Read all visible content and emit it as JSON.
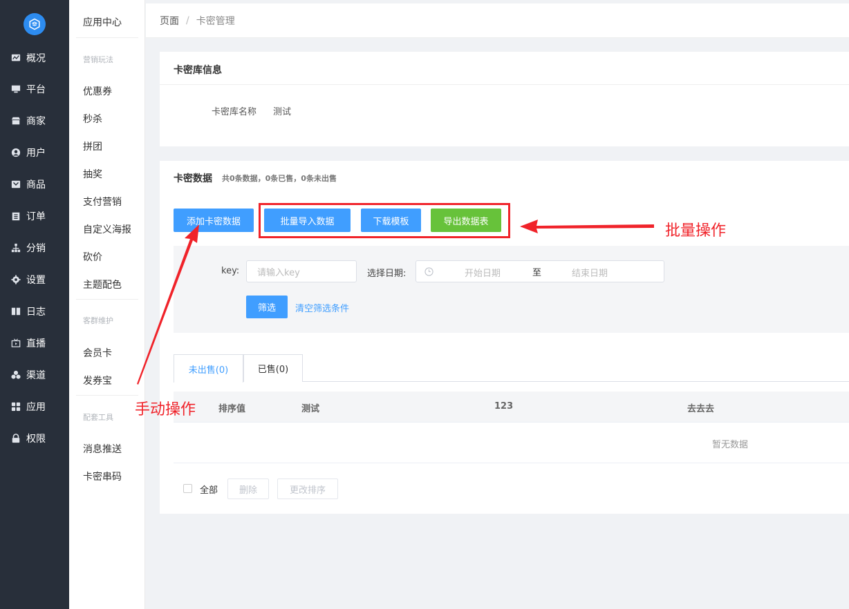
{
  "sidebar": {
    "items": [
      {
        "label": "概况",
        "icon": "chart-icon"
      },
      {
        "label": "平台",
        "icon": "monitor-icon"
      },
      {
        "label": "商家",
        "icon": "store-icon"
      },
      {
        "label": "用户",
        "icon": "user-icon"
      },
      {
        "label": "商品",
        "icon": "product-icon"
      },
      {
        "label": "订单",
        "icon": "clipboard-icon"
      },
      {
        "label": "分销",
        "icon": "network-icon"
      },
      {
        "label": "设置",
        "icon": "gear-icon"
      },
      {
        "label": "日志",
        "icon": "book-icon"
      },
      {
        "label": "直播",
        "icon": "tv-icon"
      },
      {
        "label": "渠道",
        "icon": "cluster-icon"
      },
      {
        "label": "应用",
        "icon": "grid-icon"
      },
      {
        "label": "权限",
        "icon": "lock-icon"
      }
    ]
  },
  "submenu": {
    "title": "应用中心",
    "group1": "营销玩法",
    "items1": [
      "优惠券",
      "秒杀",
      "拼团",
      "抽奖",
      "支付营销",
      "自定义海报",
      "砍价",
      "主题配色"
    ],
    "group2": "客群维护",
    "items2": [
      "会员卡",
      "发券宝"
    ],
    "group3": "配套工具",
    "items3": [
      "消息推送",
      "卡密串码"
    ]
  },
  "breadcrumb": {
    "root": "页面",
    "sep": "/",
    "current": "卡密管理"
  },
  "info": {
    "title": "卡密库信息",
    "name_label": "卡密库名称",
    "name_value": "测试"
  },
  "data": {
    "title": "卡密数据",
    "summary": "共0条数据，0条已售，0条未出售",
    "buttons": {
      "add": "添加卡密数据",
      "import": "批量导入数据",
      "template": "下载模板",
      "export": "导出数据表"
    },
    "filter": {
      "key_label": "key:",
      "key_placeholder": "请输入key",
      "date_label": "选择日期:",
      "start_placeholder": "开始日期",
      "to": "至",
      "end_placeholder": "结束日期",
      "submit": "筛选",
      "clear": "清空筛选条件"
    },
    "tabs": [
      "未出售(0)",
      "已售(0)"
    ],
    "columns": [
      "排序值",
      "测试",
      "123",
      "去去去"
    ],
    "empty": "暂无数据",
    "footer": {
      "all": "全部",
      "delete": "删除",
      "reorder": "更改排序"
    }
  },
  "annotations": {
    "batch": "批量操作",
    "manual": "手动操作",
    "color": "#f0232a"
  }
}
